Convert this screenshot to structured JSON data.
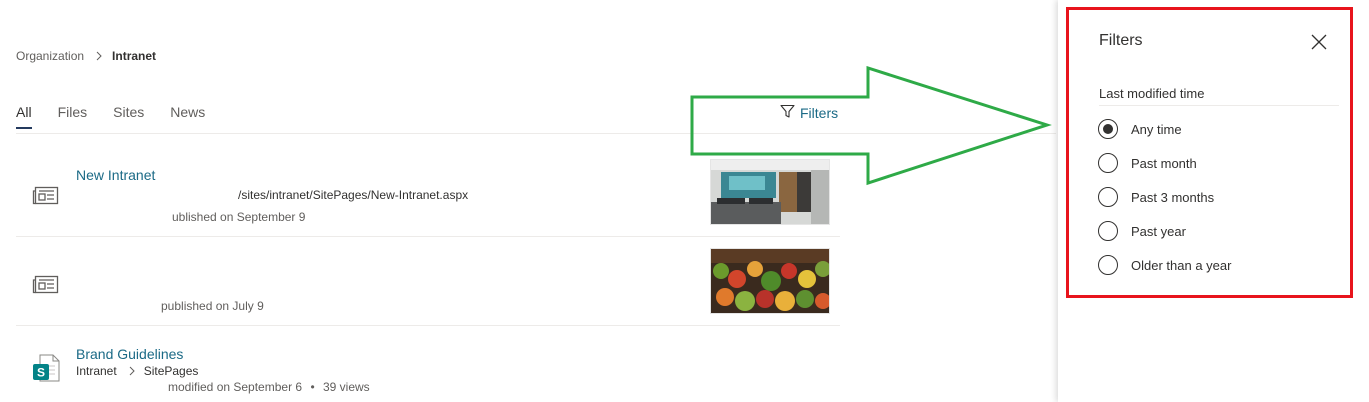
{
  "breadcrumb": {
    "root": "Organization",
    "current": "Intranet"
  },
  "tabs": [
    {
      "label": "All",
      "active": true
    },
    {
      "label": "Files",
      "active": false
    },
    {
      "label": "Sites",
      "active": false
    },
    {
      "label": "News",
      "active": false
    }
  ],
  "filters_button": {
    "label": "Filters",
    "icon": "filter-icon"
  },
  "results": [
    {
      "title": "New Intranet",
      "url": "/sites/intranet/SitePages/New-Intranet.aspx",
      "meta": "ublished on September 9",
      "icon": "news-icon",
      "thumbnail": "office-photo"
    },
    {
      "title": "",
      "meta": "published on July 9",
      "icon": "news-icon",
      "thumbnail": "vegetable-market-photo"
    },
    {
      "title": "Brand Guidelines",
      "path_site": "Intranet",
      "path_folder": "SitePages",
      "meta": "modified on September 6",
      "views": "39 views",
      "icon": "sharepoint-page-icon",
      "icon_letter": "S"
    }
  ],
  "filter_panel": {
    "title": "Filters",
    "section_label": "Last modified time",
    "options": [
      {
        "label": "Any time",
        "checked": true
      },
      {
        "label": "Past month",
        "checked": false
      },
      {
        "label": "Past 3 months",
        "checked": false
      },
      {
        "label": "Past year",
        "checked": false
      },
      {
        "label": "Older than a year",
        "checked": false
      }
    ]
  },
  "colors": {
    "link": "#1b6a86",
    "tab_underline": "#243a5e",
    "annotation_arrow": "#2eaa47",
    "annotation_box": "#e8141c",
    "sharepoint_green": "#038387"
  }
}
